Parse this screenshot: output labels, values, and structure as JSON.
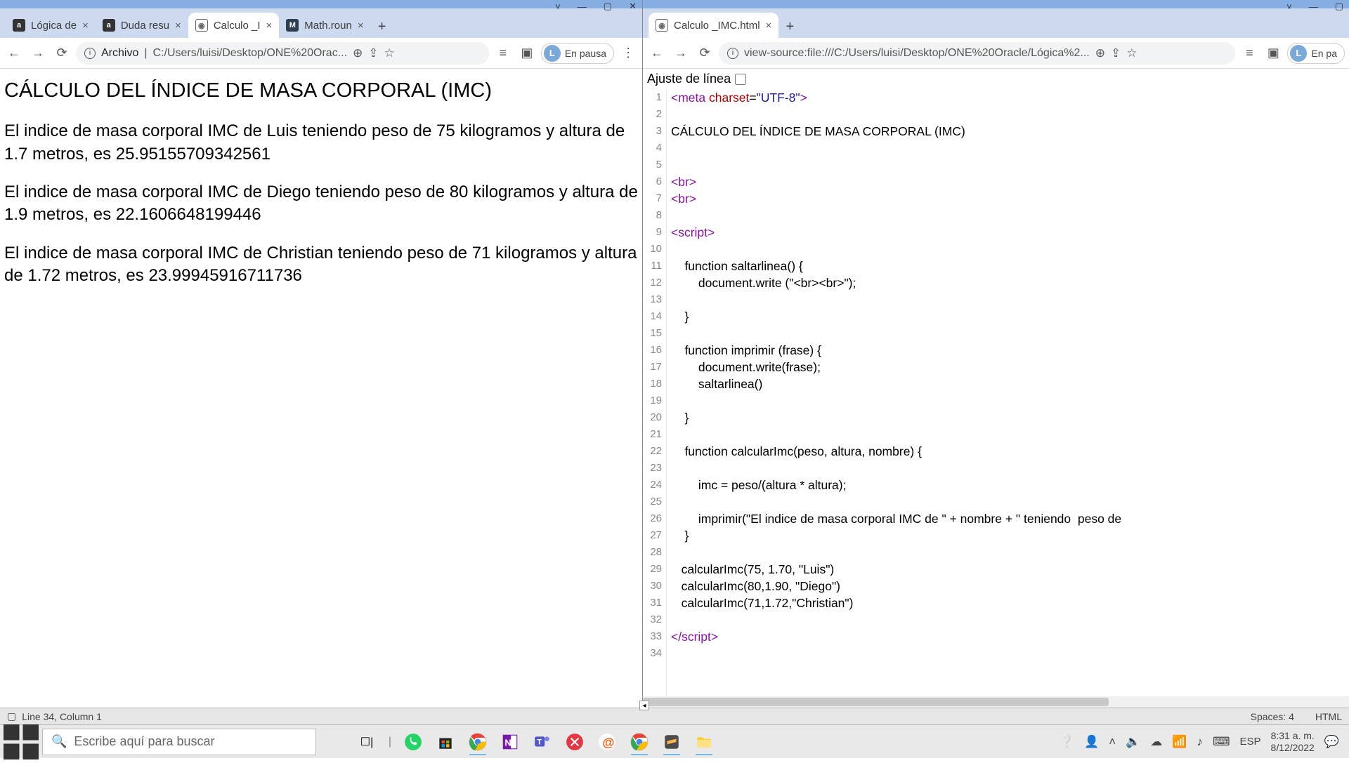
{
  "leftWindow": {
    "tabs": [
      {
        "title": "Lógica de",
        "fav": "a"
      },
      {
        "title": "Duda resu",
        "fav": "a"
      },
      {
        "title": "Calculo _I",
        "fav": "globe",
        "active": true
      },
      {
        "title": "Math.roun",
        "fav": "m"
      }
    ],
    "address": {
      "label": "Archivo",
      "url": "C:/Users/luisi/Desktop/ONE%20Orac..."
    },
    "profile": {
      "initial": "L",
      "status": "En pausa"
    },
    "page": {
      "heading": "CÁLCULO DEL ÍNDICE DE MASA CORPORAL (IMC)",
      "p1": "El indice de masa corporal IMC de Luis teniendo peso de 75 kilogramos y altura de 1.7 metros, es 25.95155709342561",
      "p2": "El indice de masa corporal IMC de Diego teniendo peso de 80 kilogramos y altura de 1.9 metros, es 22.1606648199446",
      "p3": "El indice de masa corporal IMC de Christian teniendo peso de 71 kilogramos y altura de 1.72 metros, es 23.99945916711736"
    }
  },
  "rightWindow": {
    "tabs": [
      {
        "title": "Calculo _IMC.html",
        "fav": "globe",
        "active": true
      }
    ],
    "address": {
      "url": "view-source:file:///C:/Users/luisi/Desktop/ONE%20Oracle/Lógica%2..."
    },
    "profile": {
      "initial": "L",
      "status": "En pa"
    },
    "wrapLabel": "Ajuste de línea",
    "lineCount": 34
  },
  "statusbar": {
    "left": "Line 34, Column 1",
    "spaces": "Spaces: 4",
    "lang": "HTML"
  },
  "taskbar": {
    "searchPlaceholder": "Escribe aquí para buscar",
    "lang": "ESP",
    "time": "8:31 a. m.",
    "date": "8/12/2022"
  }
}
